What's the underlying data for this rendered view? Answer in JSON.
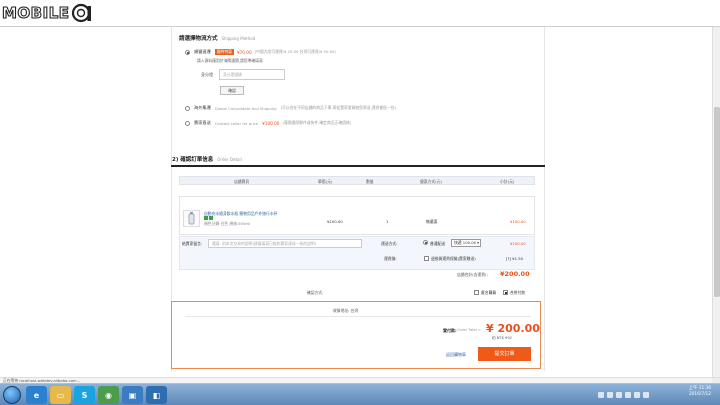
{
  "site": {
    "logo_text": "MOBILE"
  },
  "shipping": {
    "title": "請選擇物流方式",
    "subtitle": "Shipping Method",
    "options": [
      {
        "name": "順豐速運",
        "badge": "限時特惠",
        "price": "¥70.00",
        "note": "(中國大陸可運費/¥ 25.00 台灣可運費/¥ 50.00)",
        "selected": true
      },
      {
        "name": "海外集運",
        "en": "Global Consolidate and Shipping",
        "note": "(可以合在不同店鋪的商品下單,再從賣家發貨給您寄送,運費會低一些)",
        "selected": false
      },
      {
        "name": "賣家直送",
        "en": "Contact seller for price",
        "price": "¥100.00",
        "note": "(僅限國際郵件或快件,確定商品正確價格)",
        "selected": false
      }
    ],
    "id_hint": "請入資料僅用於海關通關,請您準確填寫",
    "id_label": "身分證",
    "id_placeholder": "身分證號碼",
    "confirm_label": "確認"
  },
  "order": {
    "title": "2) 確認訂單信息",
    "subtitle": "Order Detail",
    "columns": [
      "店鋪寶貝",
      "單價(元)",
      "數量",
      "優惠方式(元)",
      "小計(元)"
    ],
    "shop_label": "店鋪:",
    "product": {
      "name": "自動充水隨身飲水瓶 寵物用品戶外旅行水杯",
      "spec": "顏色分類:白色 規格:500ml",
      "price": "¥100.00",
      "qty": "1",
      "discount": "無優惠",
      "subtotal": "¥100.00"
    },
    "message_label": "給賣家留言:",
    "message_placeholder": "選填: 對本次交易的說明(建議填寫已經和賣家達成一致的說明)",
    "delivery_label": "運送方式:",
    "delivery_option": "普通配送",
    "delivery_select": "快遞 100.00",
    "delivery_price": "¥100.00",
    "insurance_label": "運費險:",
    "insurance_text": "退換貨運費保險(賣家贈送)",
    "insurance_price": "[?] ¥1.50",
    "shop_total_label": "店鋪合計(含運費):",
    "shop_total": "¥200.00",
    "invoice_label": "確認方式:",
    "check_anonymous": "匿名購買",
    "check_consolidate": "合併付款"
  },
  "summary": {
    "address": "收貨地址: 台灣",
    "pay_label": "實付款:",
    "pay_en": "Order Total ≈",
    "total": "¥ 200.00",
    "twd": "約 NT$ 992",
    "back_label": "返回購物車",
    "submit_label": "提交訂單"
  },
  "statusbar": {
    "text": "正在等待 localhost.webdev.alibaba.com..."
  },
  "taskbar": {
    "clock_time": "上午 11:36",
    "clock_date": "2016/7/12"
  }
}
